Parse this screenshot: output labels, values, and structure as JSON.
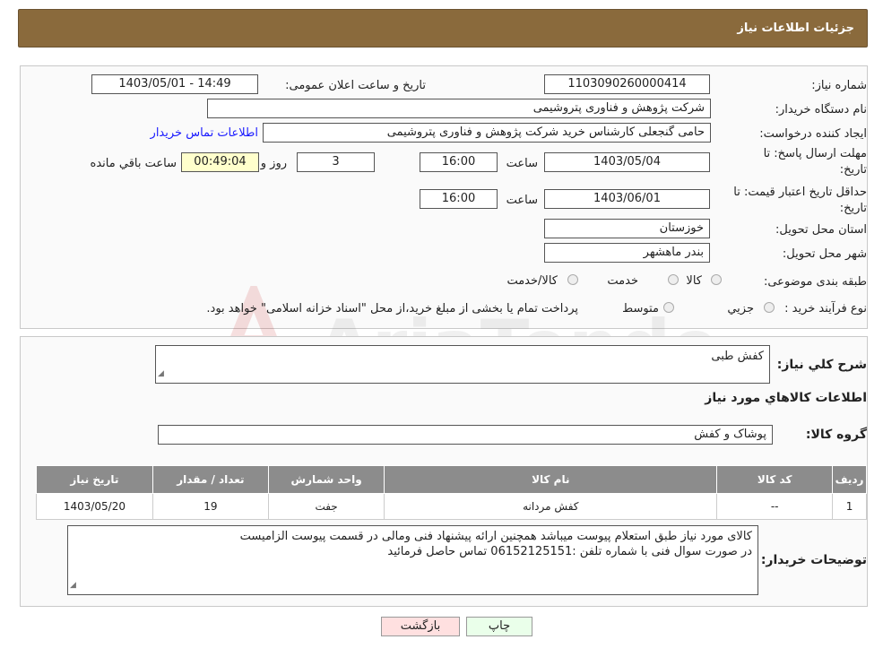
{
  "header": {
    "title": "جزئیات اطلاعات نیاز"
  },
  "info": {
    "need_number_label": "شماره نیاز:",
    "need_number": "1103090260000414",
    "announce_label": "تاریخ و ساعت اعلان عمومی:",
    "announce_value": "1403/05/01 - 14:49",
    "buyer_org_label": "نام دستگاه خریدار:",
    "buyer_org": "شرکت پژوهش و فناوری پتروشیمی",
    "requester_label": "ایجاد کننده درخواست:",
    "requester": "حامی گنجعلی کارشناس خرید شرکت پژوهش و فناوری پتروشیمی",
    "contact_link": "اطلاعات تماس خریدار",
    "deadline_label_1": "مهلت ارسال پاسخ: تا",
    "deadline_label_2": "تاریخ:",
    "deadline_date": "1403/05/04",
    "time_label": "ساعت",
    "deadline_time": "16:00",
    "days_value": "3",
    "days_label": "روز و",
    "remaining_time": "00:49:04",
    "remaining_label": "ساعت باقي مانده",
    "validity_label_1": "حداقل تاریخ اعتبار قیمت: تا",
    "validity_label_2": "تاریخ:",
    "validity_date": "1403/06/01",
    "validity_time": "16:00",
    "province_label": "استان محل تحویل:",
    "province": "خوزستان",
    "city_label": "شهر محل تحویل:",
    "city": "بندر ماهشهر",
    "category_label": "طبقه بندی موضوعی:",
    "category_options": [
      "کالا",
      "خدمت",
      "کالا/خدمت"
    ],
    "process_label": "نوع فرآیند خرید :",
    "process_options": [
      "جزيي",
      "متوسط"
    ],
    "process_note": "پرداخت تمام یا بخشی از مبلغ خرید،از محل \"اسناد خزانه اسلامی\" خواهد بود."
  },
  "details": {
    "desc_label": "شرح کلي نياز:",
    "desc_value": "کفش طبی",
    "goods_heading": "اطلاعات کالاهاي مورد نياز",
    "group_label": "گروه کالا:",
    "group_value": "پوشاک و کفش",
    "table": {
      "headers": [
        "رديف",
        "کد کالا",
        "نام کالا",
        "واحد شمارش",
        "تعداد / مقدار",
        "تاریخ نیاز"
      ],
      "rows": [
        [
          "1",
          "--",
          "کفش مردانه",
          "جفت",
          "19",
          "1403/05/20"
        ]
      ]
    },
    "buyer_notes_label": "توضیحات خریدار:",
    "buyer_notes_line1": "کالای مورد نیاز طبق استعلام پیوست میباشد همچنین ارائه پیشنهاد فنی ومالی در قسمت پیوست الزامیست",
    "buyer_notes_line2": "در صورت سوال فنی با شماره تلفن :06152125151 تماس حاصل فرمائید"
  },
  "buttons": {
    "print": "چاپ",
    "back": "بازگشت"
  },
  "colors": {
    "header": "#8a6a3c",
    "table_header": "#8c8c8c",
    "back_button": "#ffe0e0",
    "print_button": "#eaffea"
  }
}
